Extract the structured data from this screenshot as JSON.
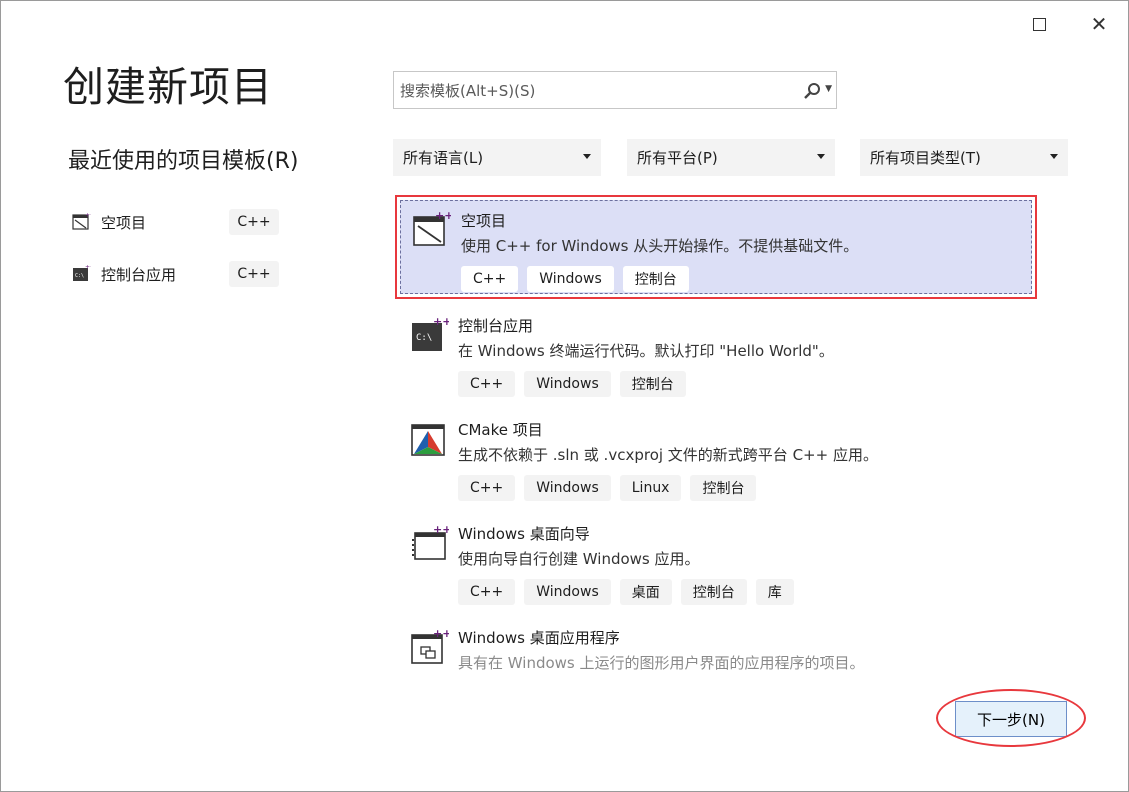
{
  "window": {
    "maximize_icon": "maximize-icon",
    "close_label": "✕"
  },
  "page_title": "创建新项目",
  "recent": {
    "title": "最近使用的项目模板(R)",
    "items": [
      {
        "label": "空项目",
        "tag": "C++",
        "icon": "empty-project-icon"
      },
      {
        "label": "控制台应用",
        "tag": "C++",
        "icon": "console-app-icon"
      }
    ]
  },
  "search": {
    "placeholder": "搜索模板(Alt+S)(S)",
    "value": ""
  },
  "filters": [
    {
      "label": "所有语言(L)"
    },
    {
      "label": "所有平台(P)"
    },
    {
      "label": "所有项目类型(T)"
    }
  ],
  "templates": [
    {
      "name": "空项目",
      "desc": "使用 C++ for Windows 从头开始操作。不提供基础文件。",
      "tags": [
        "C++",
        "Windows",
        "控制台"
      ],
      "selected": true
    },
    {
      "name": "控制台应用",
      "desc": "在 Windows 终端运行代码。默认打印 \"Hello World\"。",
      "tags": [
        "C++",
        "Windows",
        "控制台"
      ]
    },
    {
      "name": "CMake 项目",
      "desc": "生成不依赖于 .sln 或 .vcxproj 文件的新式跨平台 C++ 应用。",
      "tags": [
        "C++",
        "Windows",
        "Linux",
        "控制台"
      ]
    },
    {
      "name": "Windows 桌面向导",
      "desc": "使用向导自行创建 Windows 应用。",
      "tags": [
        "C++",
        "Windows",
        "桌面",
        "控制台",
        "库"
      ]
    },
    {
      "name": "Windows 桌面应用程序",
      "desc": "具有在 Windows 上运行的图形用户界面的应用程序的项目。",
      "tags": []
    }
  ],
  "next_button": "下一步(N)",
  "colors": {
    "selected_bg": "#dcdff6",
    "highlight_red": "#e8383d",
    "tag_bg": "#f3f3f3",
    "button_bg": "#e5f1fb"
  }
}
